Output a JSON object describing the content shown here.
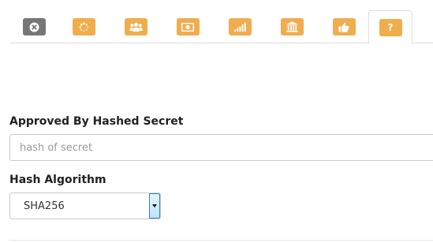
{
  "tabs": [
    {
      "icon": "close-circle-icon",
      "color": "#777777",
      "active": false
    },
    {
      "icon": "spinner-icon",
      "color": "#f0ad4e",
      "active": false
    },
    {
      "icon": "group-users-icon",
      "color": "#f0ad4e",
      "active": false
    },
    {
      "icon": "money-icon",
      "color": "#f0ad4e",
      "active": false
    },
    {
      "icon": "signal-bars-icon",
      "color": "#f0ad4e",
      "active": false
    },
    {
      "icon": "bank-icon",
      "color": "#f0ad4e",
      "active": false
    },
    {
      "icon": "thumbs-up-icon",
      "color": "#f0ad4e",
      "active": false
    },
    {
      "icon": "question-icon",
      "color": "#f0ad4e",
      "active": true,
      "glyph": "?"
    }
  ],
  "form": {
    "hashed_secret_label": "Approved By Hashed Secret",
    "hashed_secret_placeholder": "hash of secret",
    "hashed_secret_value": "",
    "hash_algorithm_label": "Hash Algorithm",
    "hash_algorithm_value": "SHA256"
  }
}
